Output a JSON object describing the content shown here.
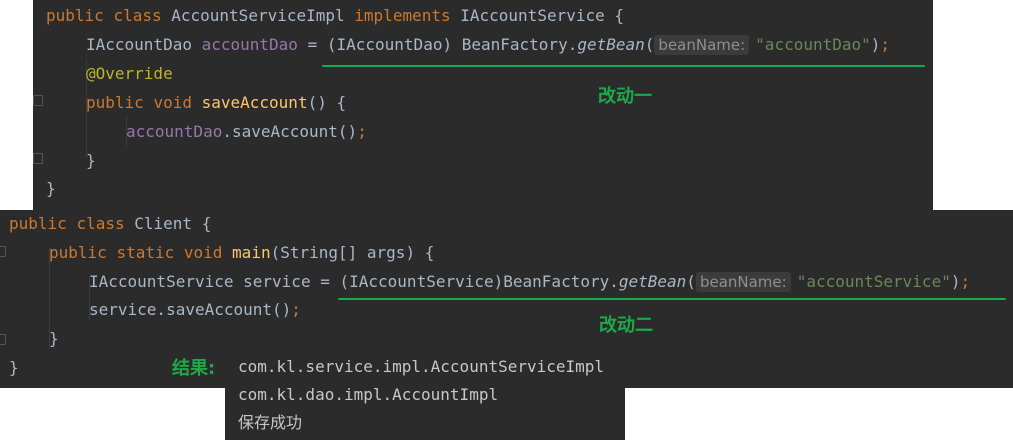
{
  "service_impl": {
    "line1": {
      "kw1": "public",
      "kw2": "class",
      "name": "AccountServiceImpl",
      "kw3": "implements",
      "iface": "IAccountService",
      "brace": "{"
    },
    "line2": {
      "type": "IAccountDao",
      "field": "accountDao",
      "assign": "=",
      "cast": "(IAccountDao)",
      "cls": "BeanFactory.",
      "method": "getBean",
      "open": "(",
      "hint": "beanName:",
      "arg": "\"accountDao\"",
      "close": ")",
      "semi": ";"
    },
    "line3": {
      "annotation": "@Override"
    },
    "line4": {
      "kw1": "public",
      "kw2": "void",
      "method": "saveAccount",
      "rest": "() {"
    },
    "line5": {
      "field": "accountDao",
      "call": ".saveAccount()",
      "semi": ";"
    },
    "line6": {
      "brace": "}"
    },
    "line7": {
      "brace": "}"
    },
    "note": "改动一"
  },
  "client": {
    "line1": {
      "kw1": "public",
      "kw2": "class",
      "name": "Client",
      "brace": "{"
    },
    "line2": {
      "kw1": "public",
      "kw2": "static",
      "kw3": "void",
      "method": "main",
      "rest": "(String[] args) {"
    },
    "line3": {
      "type": "IAccountService",
      "var": "service",
      "assign": "=",
      "cast": "(IAccountService)",
      "cls": "BeanFactory.",
      "method": "getBean",
      "open": "(",
      "hint": "beanName:",
      "arg": "\"accountService\"",
      "close": ")",
      "semi": ";"
    },
    "line4": {
      "call": "service.saveAccount()",
      "semi": ";"
    },
    "line5": {
      "brace": "}"
    },
    "line6": {
      "brace": "}"
    },
    "note": "改动二"
  },
  "result": {
    "label": "结果:",
    "lines": [
      "com.kl.service.impl.AccountServiceImpl",
      "com.kl.dao.impl.AccountImpl",
      "保存成功"
    ]
  },
  "colors": {
    "editor_bg": "#2b2b2b",
    "keyword": "#cc7832",
    "method": "#ffc66d",
    "field": "#9876aa",
    "string": "#6a8759",
    "annotation": "#bbb529",
    "default_text": "#a9b7c6",
    "accent_note": "#1ea84a"
  }
}
